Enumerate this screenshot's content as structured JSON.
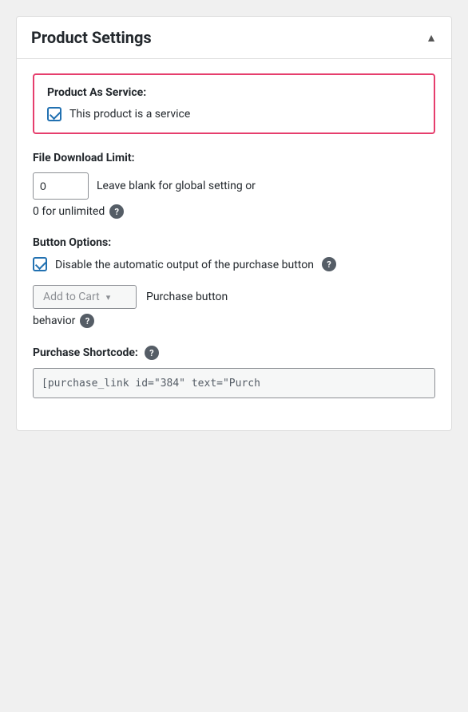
{
  "panel": {
    "title": "Product Settings",
    "collapse_icon": "▲"
  },
  "service_section": {
    "label": "Product As Service:",
    "checkbox_label": "This product is a service",
    "checked": true
  },
  "download_limit_section": {
    "label": "File Download Limit:",
    "value": "0",
    "inline_hint": "Leave blank for global setting or",
    "below_hint": "0 for unlimited"
  },
  "button_options_section": {
    "label": "Button Options:",
    "checkbox_label": "Disable the automatic output of the purchase button",
    "checked": true,
    "dropdown_value": "Add to Cart",
    "dropdown_label": "Purchase button",
    "behavior_label": "behavior"
  },
  "shortcode_section": {
    "label": "Purchase Shortcode:",
    "shortcode_value": "[purchase_link id=\"384\" text=\"Purch"
  },
  "icons": {
    "help": "?",
    "collapse": "▲",
    "chevron_down": "▾"
  }
}
